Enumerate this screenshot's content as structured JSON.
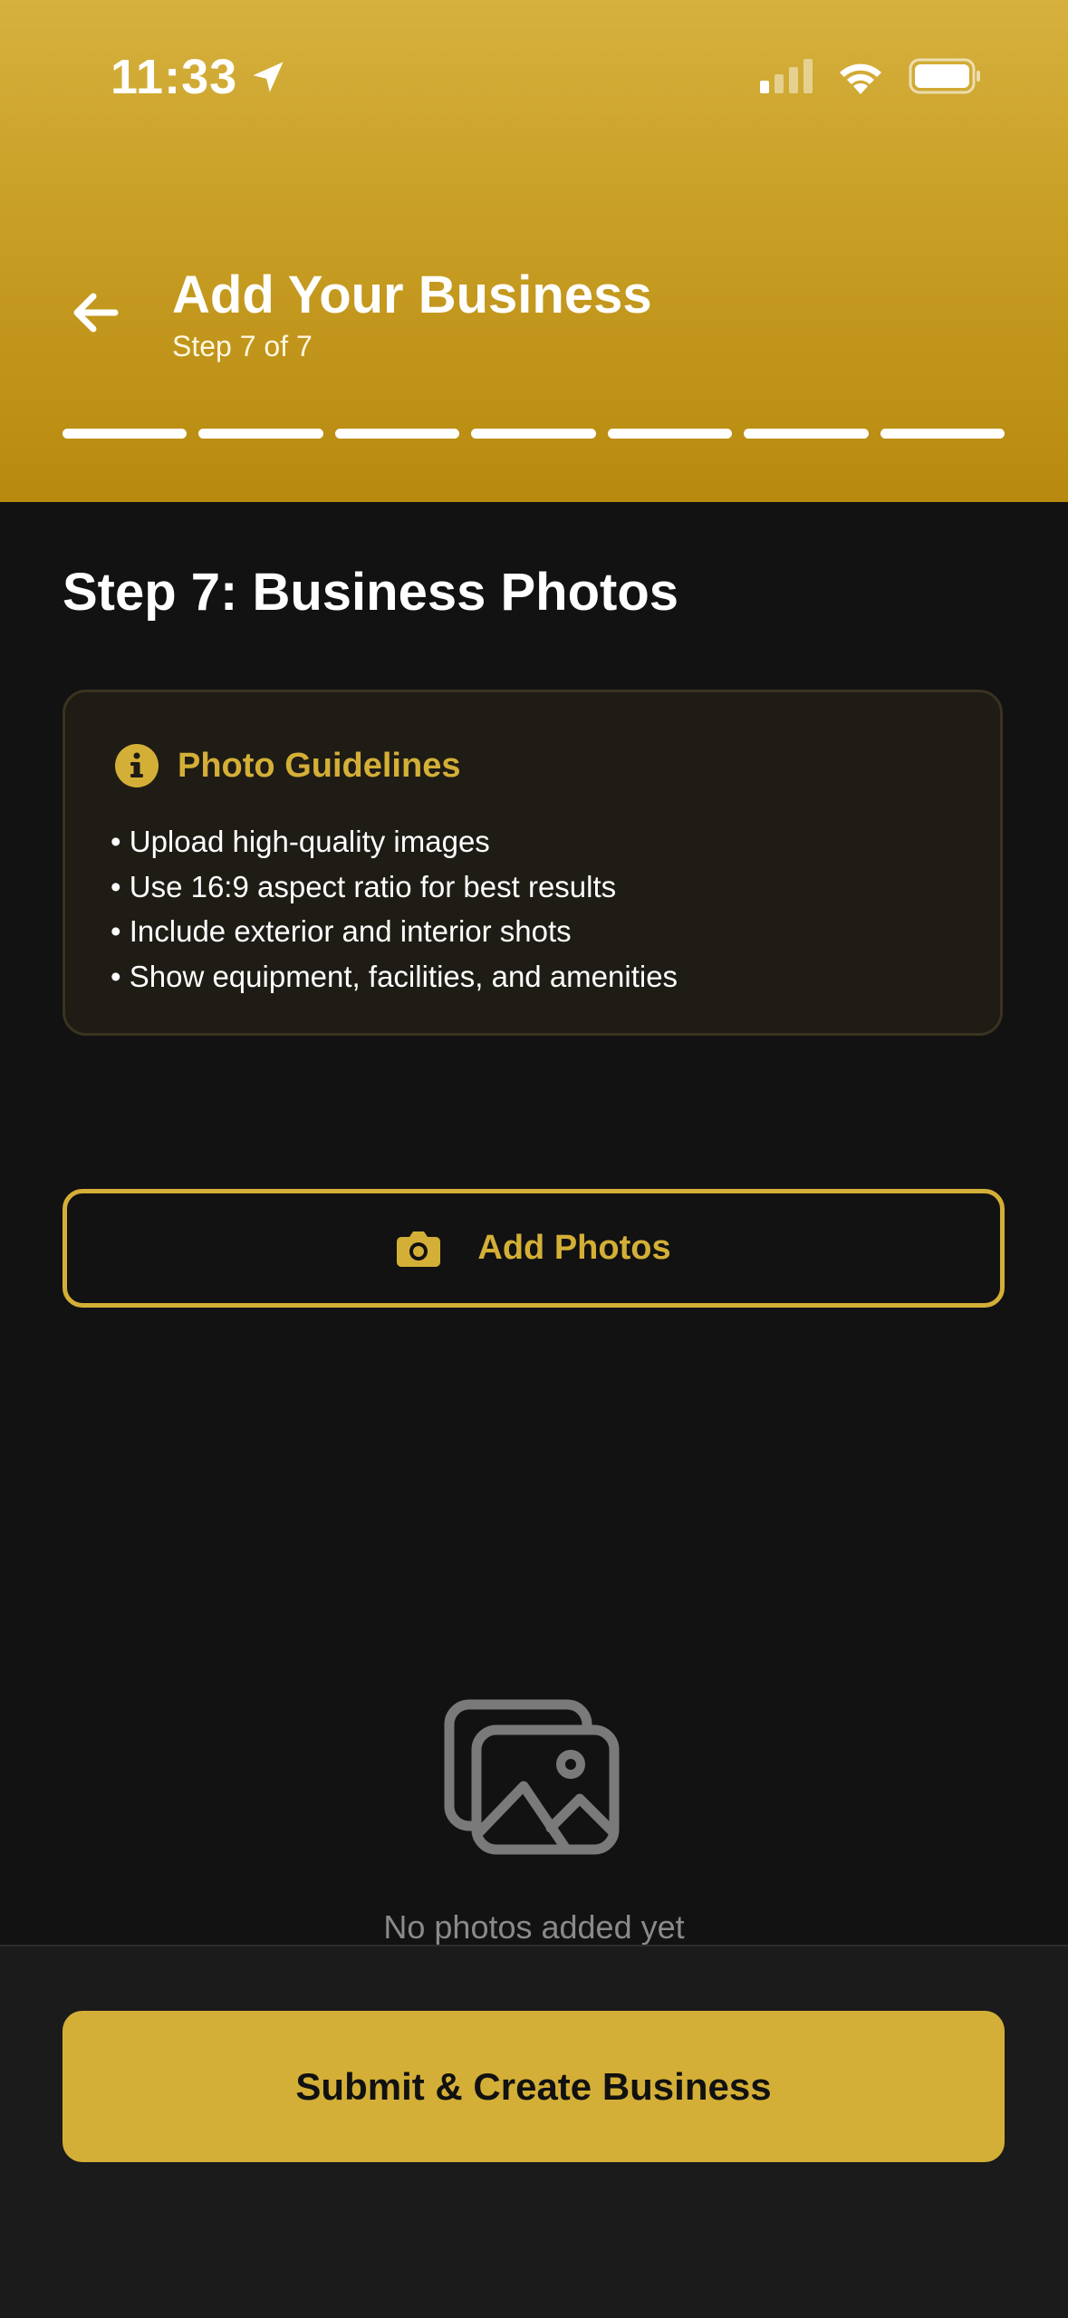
{
  "status_bar": {
    "time": "11:33"
  },
  "header": {
    "title": "Add Your Business",
    "subtitle": "Step 7 of 7",
    "progress": {
      "current_step": 7,
      "total_steps": 7
    }
  },
  "main": {
    "step_title": "Step 7: Business Photos",
    "guidelines": {
      "title": "Photo Guidelines",
      "items": [
        "Upload high-quality images",
        "Use 16:9 aspect ratio for best results",
        "Include exterior and interior shots",
        "Show equipment, facilities, and amenities"
      ]
    },
    "add_photos_label": "Add Photos",
    "empty_state_text": "No photos added yet"
  },
  "footer": {
    "submit_label": "Submit & Create Business"
  },
  "colors": {
    "accent": "#D4AF37",
    "background": "#121212",
    "card": "#1F1C15",
    "footer": "#1B1B1B"
  },
  "icons": {
    "location": "location-arrow-icon",
    "signal": "cellular-signal-icon",
    "wifi": "wifi-icon",
    "battery": "battery-icon",
    "back": "arrow-left-icon",
    "info": "info-icon",
    "camera": "camera-icon",
    "empty": "images-icon"
  }
}
